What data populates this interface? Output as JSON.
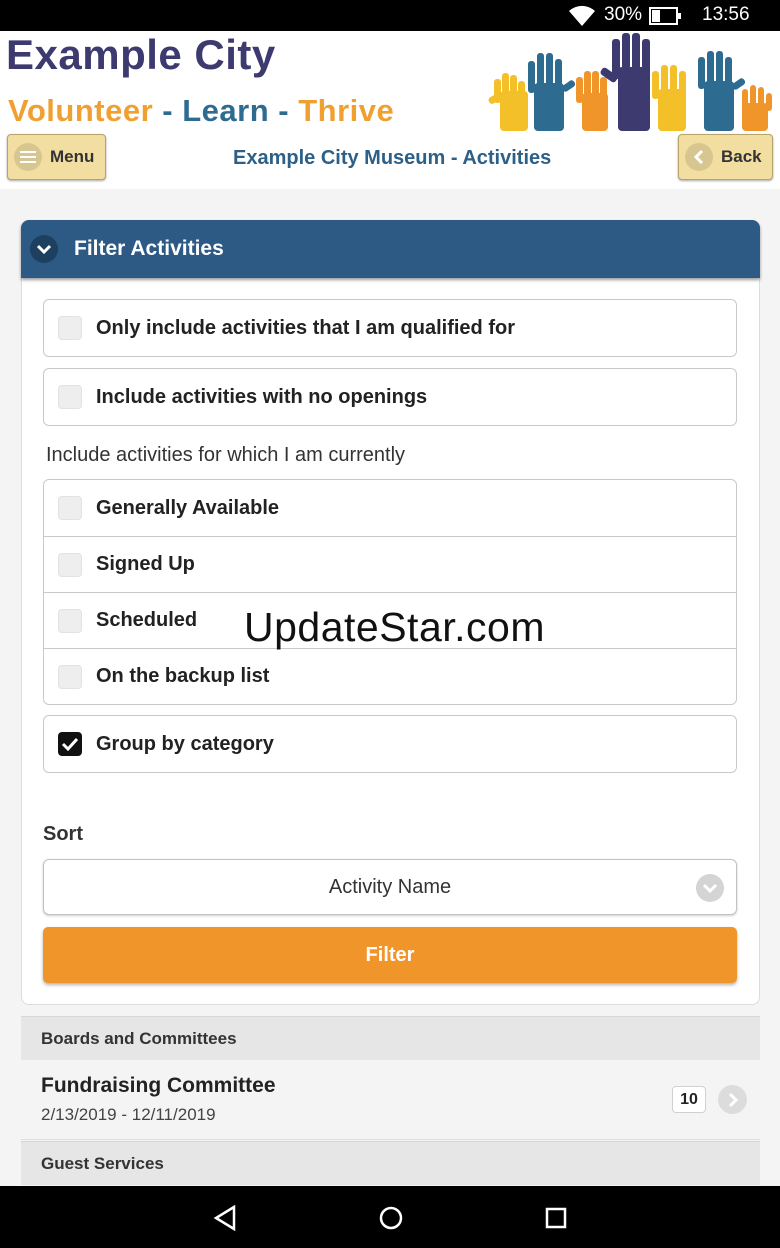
{
  "status_bar": {
    "battery_percent": "30%",
    "time": "13:56",
    "icons": [
      "wifi-icon",
      "battery-icon"
    ]
  },
  "header": {
    "brand_title": "Example City",
    "tagline": {
      "part1": "Volunteer",
      "sep1": " - ",
      "part2": "Learn",
      "sep2": " - ",
      "part3": "Thrive"
    },
    "menu_label": "Menu",
    "back_label": "Back",
    "page_title": "Example City Museum - Activities",
    "colors": {
      "brand": "#3c3a6e",
      "orange": "#f0a030",
      "blue": "#2e6b91",
      "button": "#f1dea0"
    }
  },
  "filter": {
    "title": "Filter Activities",
    "header_color": "#2c5a84",
    "options_top": [
      {
        "label": "Only include activities that I am qualified for",
        "checked": false
      },
      {
        "label": "Include activities with no openings",
        "checked": false
      }
    ],
    "status_label": "Include activities for which I am currently",
    "status_options": [
      {
        "label": "Generally Available",
        "checked": false
      },
      {
        "label": "Signed Up",
        "checked": false
      },
      {
        "label": "Scheduled",
        "checked": false
      },
      {
        "label": "On the backup list",
        "checked": false
      }
    ],
    "group_option": {
      "label": "Group by category",
      "checked": true
    },
    "sort_label": "Sort",
    "sort_value": "Activity Name",
    "filter_button": "Filter",
    "button_color": "#f0952a"
  },
  "list": {
    "groups": [
      {
        "name": "Boards and Committees",
        "items": [
          {
            "name": "Fundraising Committee",
            "dates": "2/13/2019 - 12/11/2019",
            "count": "10"
          }
        ]
      },
      {
        "name": "Guest Services",
        "items": []
      }
    ]
  },
  "watermark": "UpdateStar.com",
  "nav_bar": {
    "icons": [
      "back-triangle-icon",
      "home-circle-icon",
      "recents-square-icon"
    ]
  }
}
